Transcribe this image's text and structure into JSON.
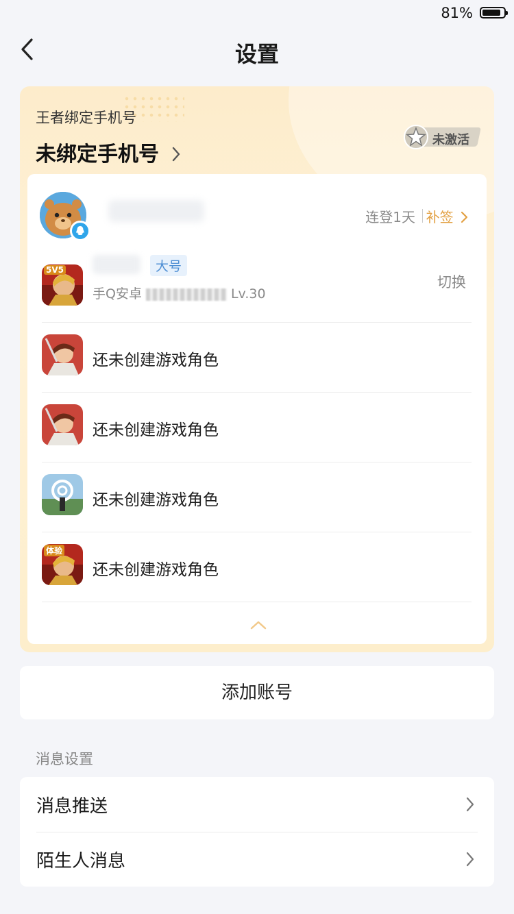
{
  "status_bar": {
    "battery": "81%"
  },
  "header": {
    "title": "设置"
  },
  "bind_phone": {
    "label": "王者绑定手机号",
    "value": "未绑定手机号",
    "badge": "未激活"
  },
  "account": {
    "login_days": "连登1天",
    "resign": "补签",
    "main_role": {
      "tag": "大号",
      "platform": "手Q安卓",
      "level": "Lv.30",
      "switch": "切换"
    },
    "other_roles": [
      {
        "text": "还未创建游戏角色",
        "icon": "hero-icon"
      },
      {
        "text": "还未创建游戏角色",
        "icon": "hero-icon"
      },
      {
        "text": "还未创建游戏角色",
        "icon": "world-icon"
      },
      {
        "text": "还未创建游戏角色",
        "icon": "trial-icon",
        "tag": "体验"
      }
    ],
    "colors": {
      "accent": "#e2a042",
      "tag_blue": "#4f8fd4",
      "qq_blue": "#2fa5ea"
    }
  },
  "add_account": "添加账号",
  "message_settings": {
    "section": "消息设置",
    "items": [
      {
        "label": "消息推送"
      },
      {
        "label": "陌生人消息"
      }
    ]
  }
}
